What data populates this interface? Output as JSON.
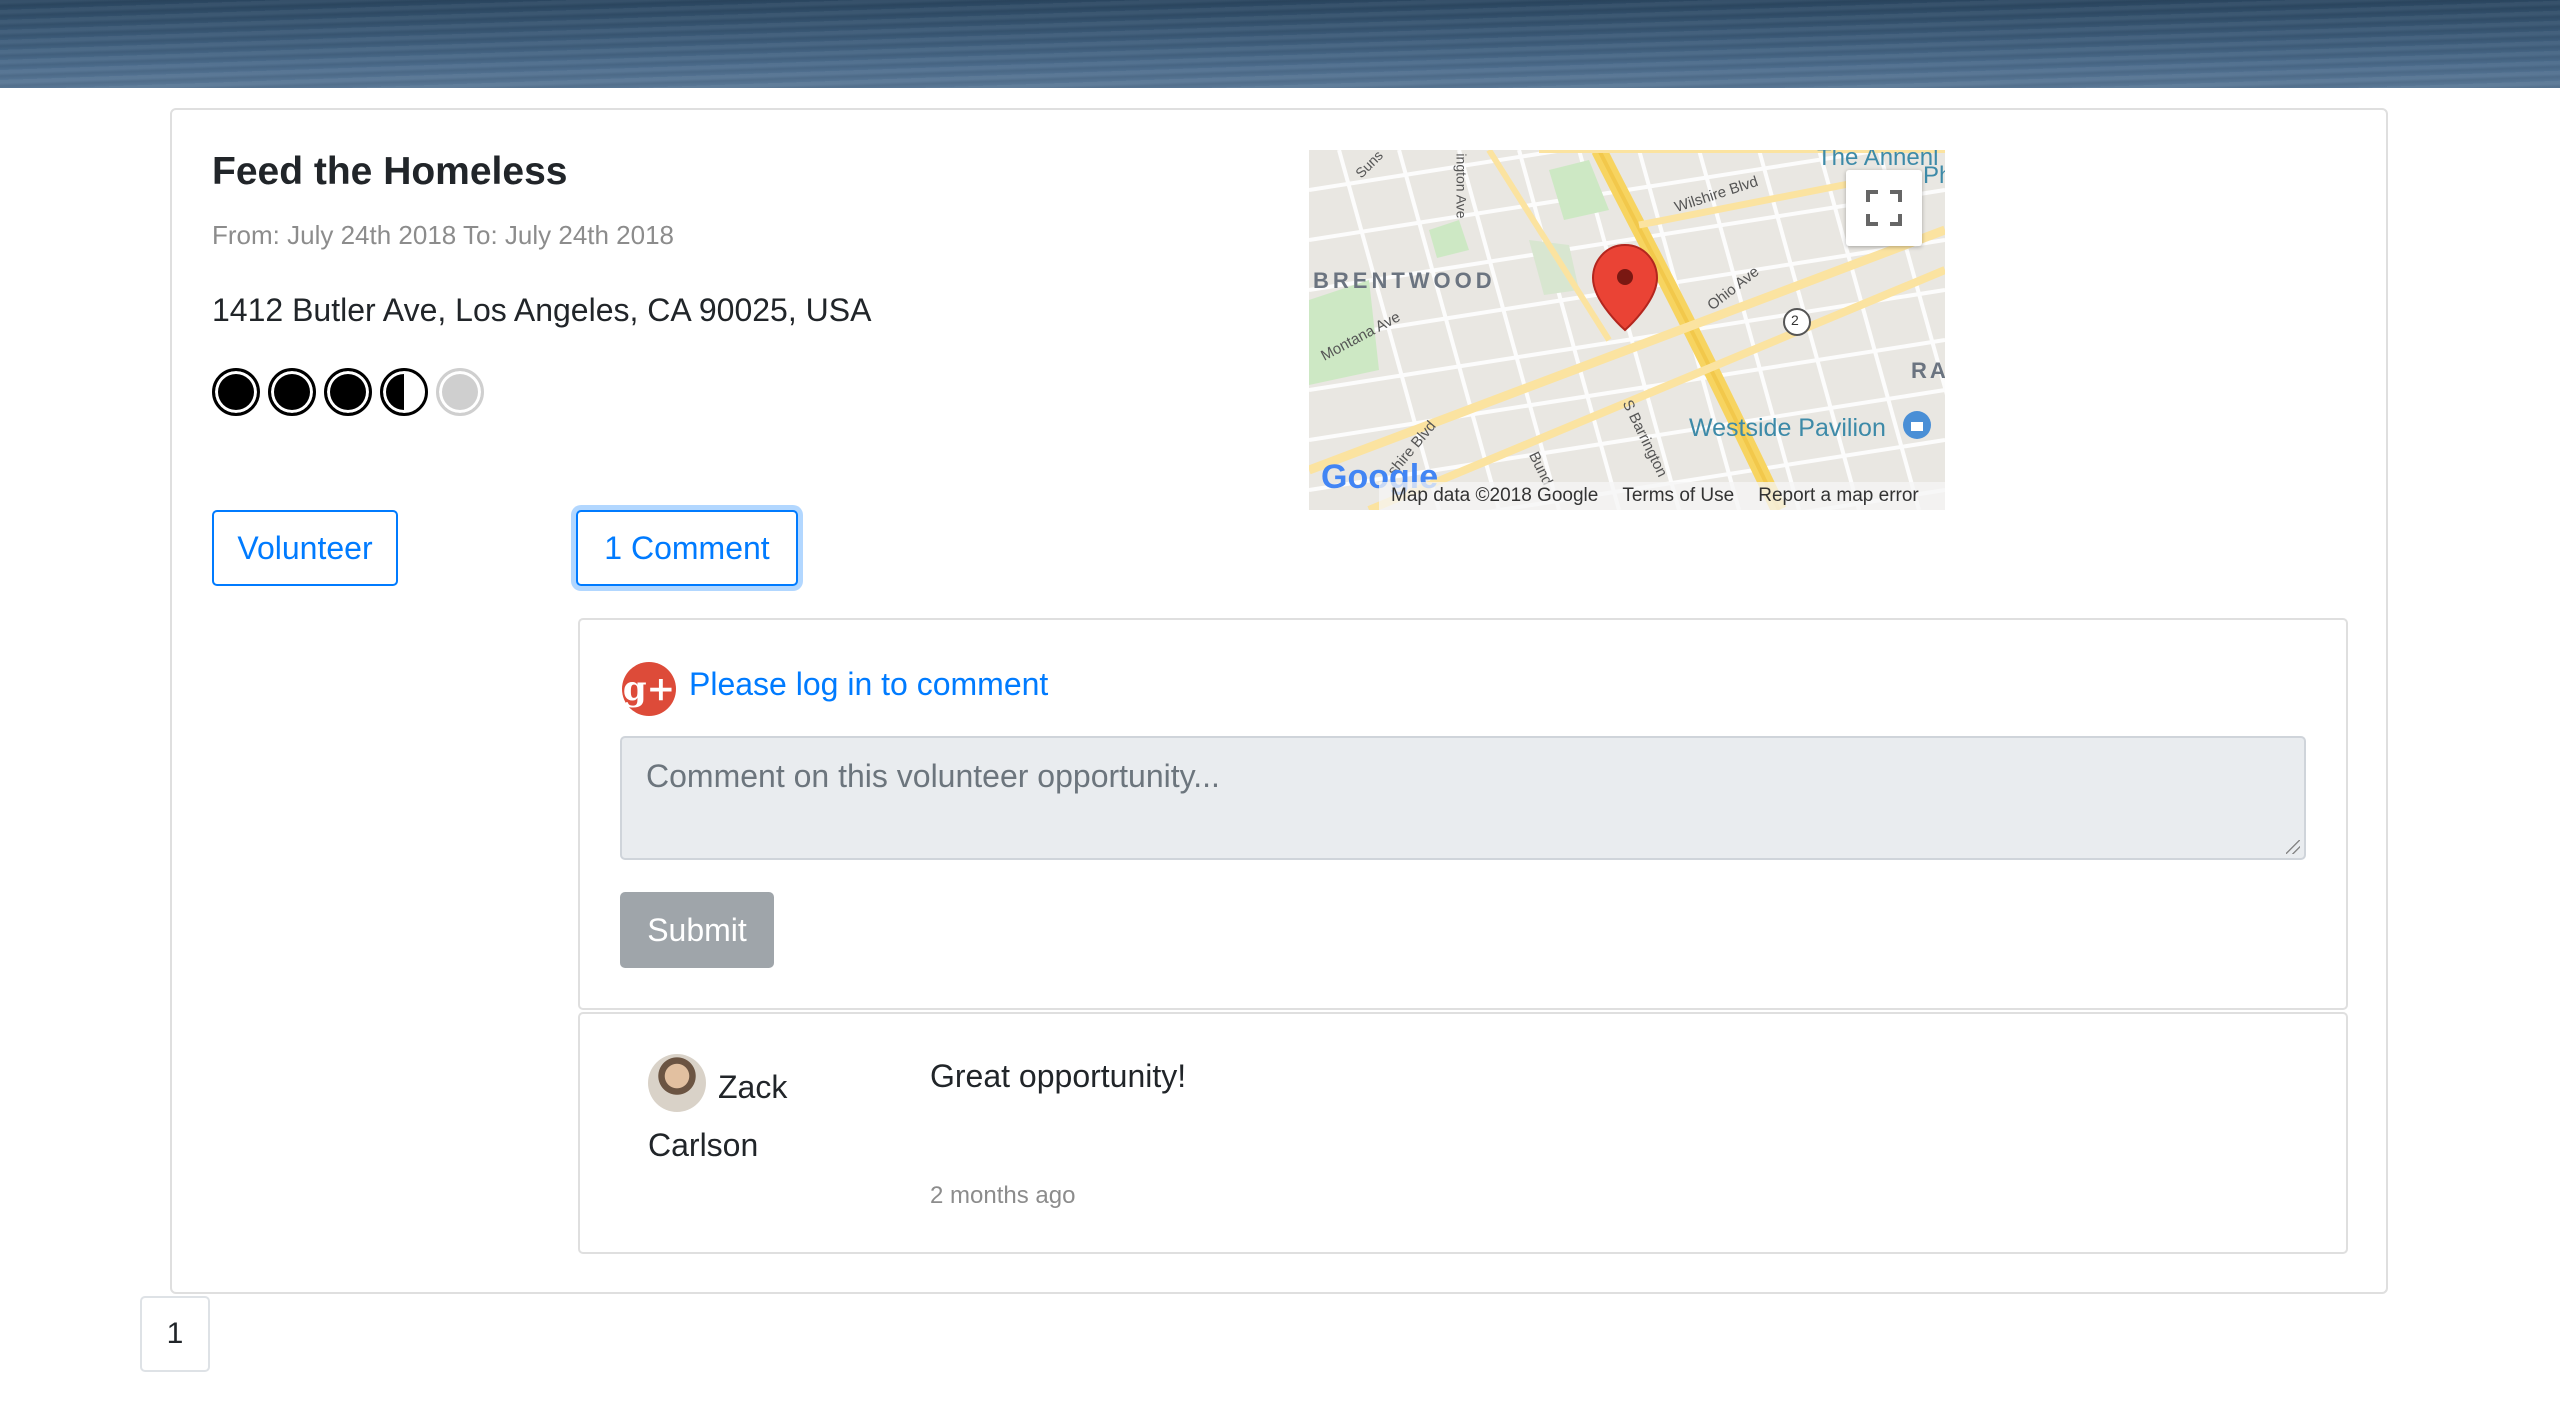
{
  "event": {
    "title": "Feed the Homeless",
    "dates": "From: July 24th 2018 To: July 24th 2018",
    "address": "1412 Butler Ave, Los Angeles, CA 90025, USA",
    "rating": 3.5,
    "rating_max": 5
  },
  "map": {
    "labels": {
      "brentwood": "BRENTWOOD",
      "westside": "Westside Pavilion",
      "annenberg": "The Annenl",
      "ph": "Ph",
      "ra": "RA",
      "wilshire": "Wilshire Blvd",
      "ohio": "Ohio Ave",
      "montana": "Montana Ave",
      "barrington": "S Barrington",
      "wilshire2": "shire Blvd",
      "bundy": "Bund",
      "sunset": "Suns",
      "lington": "ington Ave",
      "route": "2",
      "google": "Google"
    },
    "attribution": {
      "data": "Map data ©2018 Google",
      "terms": "Terms of Use",
      "report": "Report a map error"
    }
  },
  "actions": {
    "volunteer": "Volunteer",
    "comments": "1 Comment"
  },
  "comment_form": {
    "login_link": "Please log in to comment",
    "placeholder": "Comment on this volunteer opportunity...",
    "submit": "Submit"
  },
  "comments": [
    {
      "author": "Zack Carlson",
      "text": "Great opportunity!",
      "time": "2 months ago"
    }
  ],
  "pagination": {
    "current": "1"
  },
  "colors": {
    "primary": "#007bff",
    "google_plus": "#dd4b39",
    "muted": "#8c8c8c"
  }
}
